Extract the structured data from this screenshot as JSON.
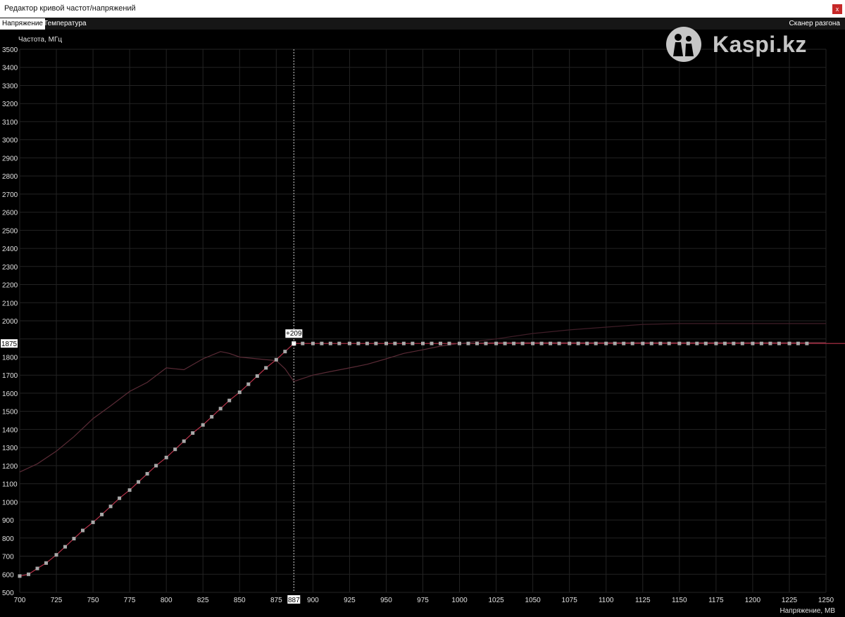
{
  "window": {
    "title": "Редактор кривой частот/напряжений",
    "close_label": "x"
  },
  "tabs": [
    {
      "label": "Напряжение",
      "active": true
    },
    {
      "label": "Температура",
      "active": false
    }
  ],
  "scanner_label": "Сканер разгона",
  "watermark": {
    "text": "Kaspi.kz"
  },
  "chart_data": {
    "type": "line",
    "ylabel": "Частота, МГц",
    "xlabel": "Напряжение, МВ",
    "xlim": [
      700,
      1250
    ],
    "ylim": [
      500,
      3500
    ],
    "x_ticks": [
      700,
      725,
      750,
      775,
      800,
      825,
      850,
      875,
      900,
      925,
      950,
      975,
      1000,
      1025,
      1050,
      1075,
      1100,
      1125,
      1150,
      1175,
      1200,
      1225,
      1250
    ],
    "y_ticks": [
      500,
      600,
      700,
      800,
      900,
      1000,
      1100,
      1200,
      1300,
      1400,
      1500,
      1600,
      1700,
      1800,
      1900,
      2000,
      2100,
      2200,
      2300,
      2400,
      2500,
      2600,
      2700,
      2800,
      2900,
      3000,
      3100,
      3200,
      3300,
      3400,
      3500
    ],
    "grid": true,
    "cursor": {
      "x": 887,
      "y": 1875,
      "x_label": "887",
      "y_label": "1875",
      "offset_label": "+209"
    },
    "series": [
      {
        "x": [
          700,
          706,
          712,
          718,
          725,
          731,
          737,
          743,
          750,
          756,
          762,
          768,
          775,
          781,
          787,
          793,
          800,
          806,
          812,
          818,
          825,
          831,
          837,
          843,
          850,
          856,
          862,
          868,
          875,
          881,
          887,
          893,
          900,
          906,
          912,
          918,
          925,
          931,
          937,
          943,
          950,
          956,
          962,
          968,
          975,
          981,
          987,
          993,
          1000,
          1006,
          1012,
          1018,
          1025,
          1031,
          1037,
          1043,
          1050,
          1056,
          1062,
          1068,
          1075,
          1081,
          1087,
          1093,
          1100,
          1106,
          1112,
          1118,
          1125,
          1131,
          1137,
          1143,
          1150,
          1156,
          1162,
          1168,
          1175,
          1181,
          1187,
          1193,
          1200,
          1206,
          1212,
          1218,
          1225,
          1231,
          1237
        ],
        "y": [
          590,
          600,
          632,
          662,
          707,
          752,
          797,
          842,
          887,
          930,
          975,
          1020,
          1065,
          1110,
          1155,
          1200,
          1245,
          1290,
          1335,
          1380,
          1425,
          1470,
          1515,
          1560,
          1605,
          1650,
          1695,
          1740,
          1785,
          1830,
          1875,
          1875,
          1875,
          1875,
          1875,
          1875,
          1875,
          1875,
          1875,
          1875,
          1875,
          1875,
          1875,
          1875,
          1875,
          1875,
          1875,
          1875,
          1875,
          1875,
          1875,
          1875,
          1875,
          1875,
          1875,
          1875,
          1875,
          1875,
          1875,
          1875,
          1875,
          1875,
          1875,
          1875,
          1875,
          1875,
          1875,
          1875,
          1875,
          1875,
          1875,
          1875,
          1875,
          1875,
          1875,
          1875,
          1875,
          1875,
          1875,
          1875,
          1875,
          1875,
          1875,
          1875,
          1875,
          1875,
          1875
        ]
      },
      {
        "x": [
          700,
          712,
          725,
          737,
          750,
          762,
          775,
          787,
          800,
          806,
          812,
          825,
          837,
          843,
          850,
          862,
          875,
          881,
          887,
          900,
          912,
          925,
          937,
          950,
          962,
          975,
          987,
          1000,
          1025,
          1050,
          1075,
          1100,
          1125,
          1150,
          1175,
          1200,
          1225,
          1250
        ],
        "y": [
          1165,
          1210,
          1280,
          1360,
          1460,
          1530,
          1610,
          1660,
          1740,
          1735,
          1730,
          1790,
          1830,
          1820,
          1800,
          1790,
          1780,
          1735,
          1665,
          1700,
          1720,
          1740,
          1760,
          1790,
          1820,
          1840,
          1860,
          1875,
          1880,
          1880,
          1880,
          1880,
          1880,
          1880,
          1880,
          1880,
          1880,
          1880
        ]
      },
      {
        "x": [
          1000,
          1025,
          1050,
          1075,
          1100,
          1125,
          1150,
          1175,
          1200,
          1225,
          1250
        ],
        "y": [
          1875,
          1900,
          1930,
          1950,
          1965,
          1980,
          1985,
          1985,
          1985,
          1985,
          1985
        ]
      }
    ]
  }
}
